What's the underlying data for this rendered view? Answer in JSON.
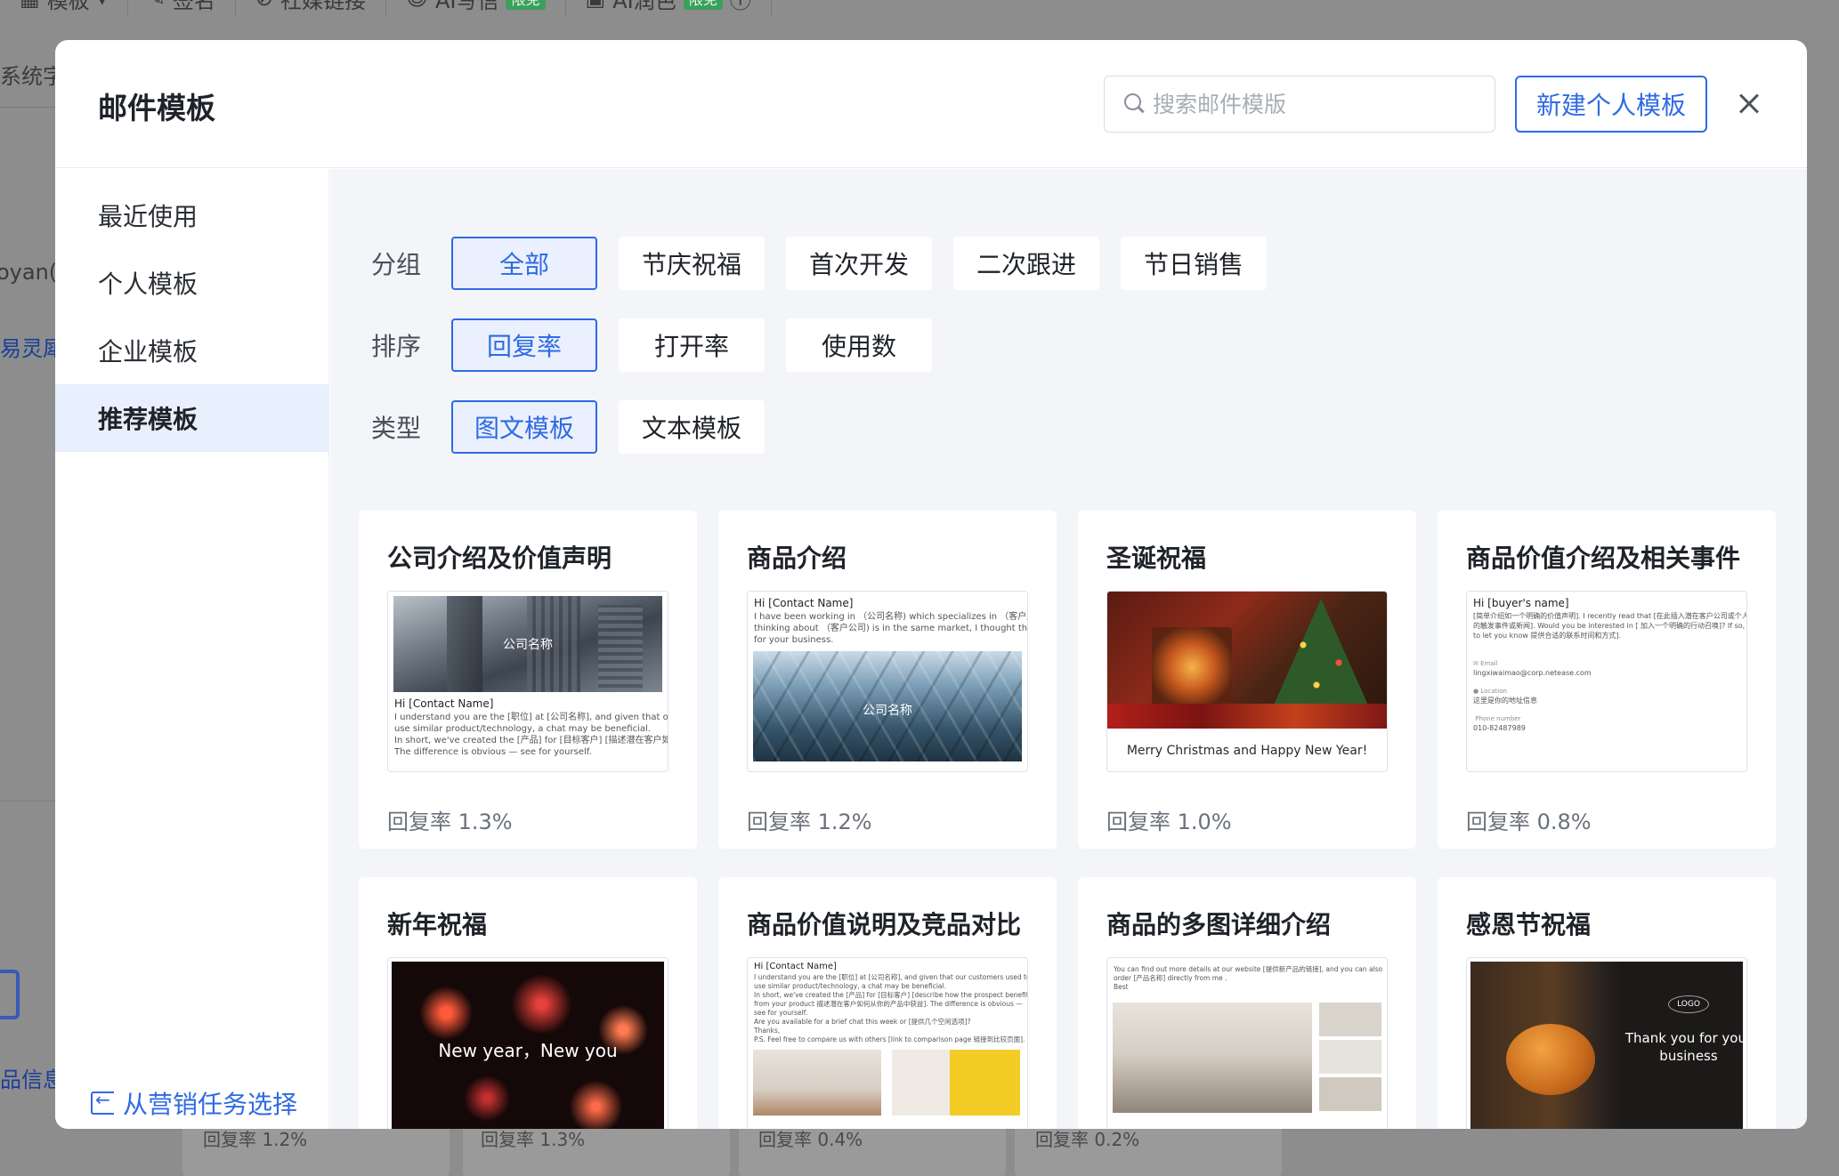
{
  "background": {
    "toolbar": [
      "模板",
      "签名",
      "社媒链接",
      "AI写信",
      "限免",
      "AI润色",
      "限免"
    ],
    "left_texts": [
      "系统字",
      "oyan(",
      "易灵犀·",
      "品信息"
    ],
    "bottom_rates": [
      "回复率 1.2%",
      "回复率 1.3%",
      "回复率 0.4%",
      "回复率 0.2%"
    ]
  },
  "modal": {
    "title": "邮件模板",
    "search_placeholder": "搜索邮件模版",
    "new_button": "新建个人模板"
  },
  "sidebar": {
    "items": [
      {
        "label": "最近使用"
      },
      {
        "label": "个人模板"
      },
      {
        "label": "企业模板"
      },
      {
        "label": "推荐模板"
      }
    ],
    "active": "推荐模板",
    "bottom_link": "从营销任务选择"
  },
  "filters": {
    "group": {
      "label": "分组",
      "options": [
        "全部",
        "节庆祝福",
        "首次开发",
        "二次跟进",
        "节日销售"
      ],
      "selected": "全部"
    },
    "sort": {
      "label": "排序",
      "options": [
        "回复率",
        "打开率",
        "使用数"
      ],
      "selected": "回复率"
    },
    "type": {
      "label": "类型",
      "options": [
        "图文模板",
        "文本模板"
      ],
      "selected": "图文模板"
    }
  },
  "cards": [
    {
      "title": "公司介绍及价值声明",
      "rate": "回复率 1.3%",
      "preview": {
        "caption": "公司名称",
        "hi": "Hi [Contact Name]",
        "lines": [
          "I understand you are the [职位] at [公司名称], and given that our customers used to",
          "use similar product/technology, a chat may be beneficial.",
          "In short, we've created the [产品] for [目标客户] [描述潜在客户如何从你的产品中获益].",
          "The difference is obvious — see for yourself."
        ]
      }
    },
    {
      "title": "商品介绍",
      "rate": "回复率 1.2%",
      "preview": {
        "hi": "Hi [Contact Name]",
        "lines": [
          "I have been working in （公司名称) which specializes in （客户所在行业）. While",
          "thinking about （客户公司) is in the same market, I thought there might be a good fit",
          "for your business."
        ],
        "caption": "公司名称"
      }
    },
    {
      "title": "圣诞祝福",
      "rate": "回复率 1.0%",
      "preview": {
        "caption": "Merry Christmas and Happy New Year!"
      }
    },
    {
      "title": "商品价值介绍及相关事件",
      "rate": "回复率 0.8%",
      "preview": {
        "hi": "Hi [buyer's name]",
        "lines": [
          "[简单介绍如一个明确的价值声明]. I recently read that [在此插入潜在客户公司或个人相关",
          "的触发事件或新闻]. Would you be interested in [ 加入一个明确的行动召唤]? If so, [way",
          "to let you know 提供合适的联系时间和方式]."
        ],
        "contacts": [
          {
            "label": "Email",
            "value": "lingxiwaimao@corp.netease.com"
          },
          {
            "label": "Location",
            "value": "这里是你的地址信息"
          },
          {
            "label": "Phone number",
            "value": "010-82487989"
          }
        ]
      }
    },
    {
      "title": "新年祝福",
      "rate": "",
      "preview": {
        "caption": "New year，New you"
      }
    },
    {
      "title": "商品价值说明及竞品对比",
      "rate": "",
      "preview": {
        "hi": "Hi [Contact Name]",
        "lines": [
          "I understand you are the [职位] at [公司名称], and given that our customers used to",
          "use similar product/technology, a chat may be beneficial.",
          "In short, we've created the [产品] for [目标客户] [describe how the prospect benefits",
          "from your product 描述潜在客户如何从你的产品中获益]. The difference is obvious —",
          "see for yourself.",
          "Are you available for a brief chat this week or [提供几个空闲选项]?",
          "",
          "Thanks,",
          "P.S. Feel free to compare us with others [link to comparison page 链接到比较页面]."
        ]
      }
    },
    {
      "title": "商品的多图详细介绍",
      "rate": "",
      "preview": {
        "lines": [
          "You can find out more details at our website [提供新产品的链接], and you can also",
          "order [产品名称] directly from me .",
          "Best"
        ]
      }
    },
    {
      "title": "感恩节祝福",
      "rate": "",
      "preview": {
        "logo": "LOGO",
        "caption": "Thank you for your business"
      }
    }
  ]
}
